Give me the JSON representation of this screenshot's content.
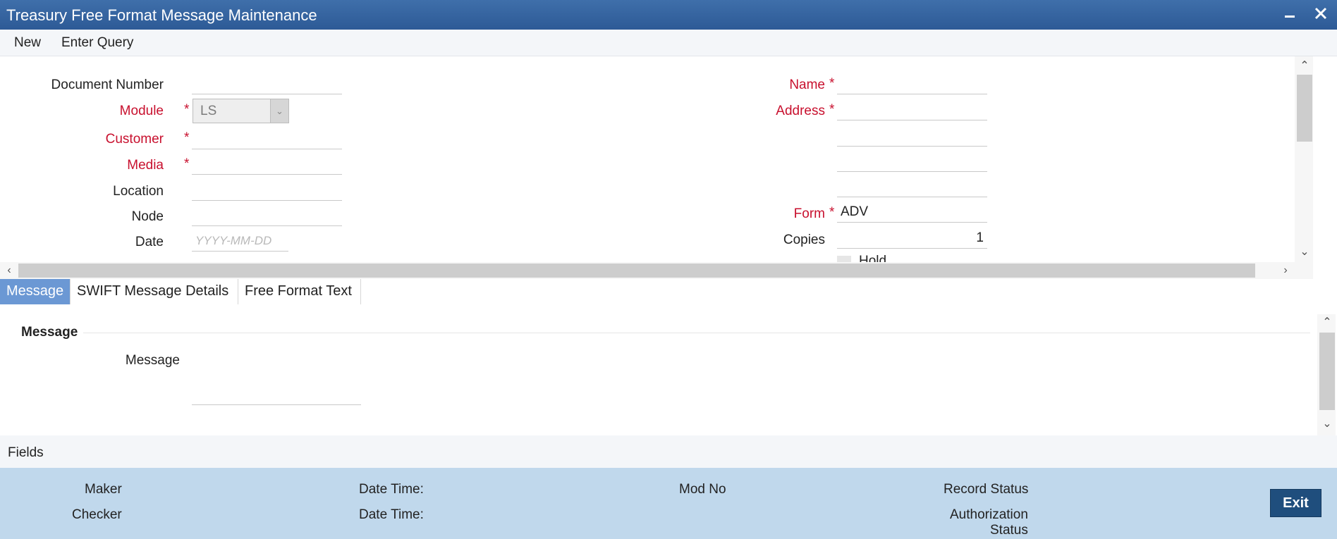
{
  "window": {
    "title": "Treasury Free Format Message Maintenance",
    "minimize_icon": "minimize-icon",
    "close_icon": "close-icon"
  },
  "toolbar": {
    "new_label": "New",
    "enter_query_label": "Enter Query"
  },
  "form": {
    "required_marker": "*",
    "document_number": {
      "label": "Document Number",
      "value": ""
    },
    "module": {
      "label": "Module",
      "value": "LS"
    },
    "customer": {
      "label": "Customer",
      "value": ""
    },
    "media": {
      "label": "Media",
      "value": ""
    },
    "location": {
      "label": "Location",
      "value": ""
    },
    "node": {
      "label": "Node",
      "value": ""
    },
    "date": {
      "label": "Date",
      "placeholder": "YYYY-MM-DD"
    },
    "name": {
      "label": "Name",
      "value": ""
    },
    "address": {
      "label": "Address",
      "line1": "",
      "line2": "",
      "line3": "",
      "line4": ""
    },
    "form_field": {
      "label": "Form",
      "value": "ADV"
    },
    "copies": {
      "label": "Copies",
      "value": "1"
    },
    "hold": {
      "label": "Hold"
    }
  },
  "tabs": [
    {
      "label": "Message",
      "active": true
    },
    {
      "label": "SWIFT Message Details",
      "active": false
    },
    {
      "label": "Free Format Text",
      "active": false
    }
  ],
  "message_section": {
    "title": "Message",
    "message_label": "Message",
    "message_value": ""
  },
  "fields_bar": {
    "label": "Fields"
  },
  "footer": {
    "maker": "Maker",
    "checker": "Checker",
    "date_time_1": "Date Time:",
    "date_time_2": "Date Time:",
    "mod_no": "Mod No",
    "record_status": "Record Status",
    "authorization_status_1": "Authorization",
    "authorization_status_2": "Status",
    "exit_label": "Exit"
  },
  "colors": {
    "title_bar": "#2d5a96",
    "required": "#c8102e",
    "active_tab": "#6b98d4",
    "footer": "#c0d8ec",
    "exit_button": "#1f4e7d"
  }
}
